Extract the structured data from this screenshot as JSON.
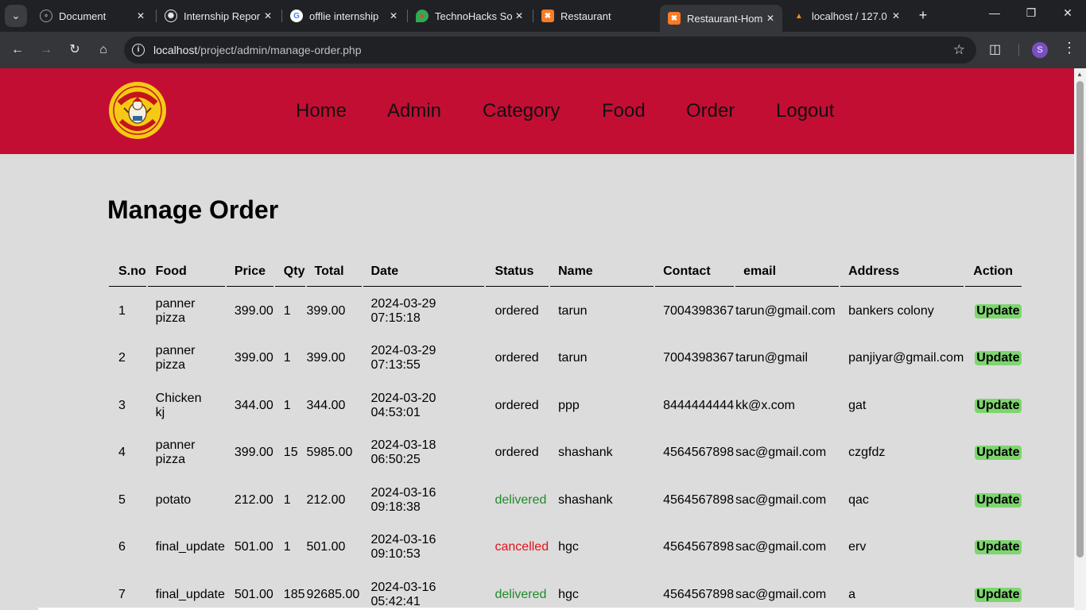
{
  "browser": {
    "tabs": [
      {
        "title": "Document",
        "favicon": "globe-icon",
        "active": false
      },
      {
        "title": "Internship Repor",
        "favicon": "chatgpt-icon",
        "active": false
      },
      {
        "title": "offlie internship",
        "favicon": "google-icon",
        "active": false
      },
      {
        "title": "TechnoHacks So",
        "favicon": "maps-pin-icon",
        "active": false
      },
      {
        "title": "Restaurant",
        "favicon": "xampp-icon",
        "active": false
      },
      {
        "title": "Restaurant-Hom",
        "favicon": "xampp-icon",
        "active": true
      },
      {
        "title": "localhost / 127.0",
        "favicon": "phpmyadmin-icon",
        "active": false
      }
    ],
    "url_host": "localhost",
    "url_path": "/project/admin/manage-order.php",
    "profile_initial": "S",
    "accent": "#7b4fbf"
  },
  "site": {
    "header_color": "#c30e33",
    "logo_text": "LOS POLLOS HERMANOS",
    "nav": [
      "Home",
      "Admin",
      "Category",
      "Food",
      "Order",
      "Logout"
    ]
  },
  "page": {
    "title": "Manage Order",
    "columns": [
      "S.no",
      "Food",
      "Price",
      "Qty",
      "Total",
      "Date",
      "Status",
      "Name",
      "Contact",
      "email",
      "Address",
      "Action"
    ],
    "rows": [
      {
        "sno": "1",
        "food": [
          "panner",
          "pizza"
        ],
        "price": "399.00",
        "qty": "1",
        "total": "399.00",
        "date": [
          "2024-03-29",
          "07:15:18"
        ],
        "status": "ordered",
        "name": "tarun",
        "contact": "7004398367",
        "email": "tarun@gmail.com",
        "address": "bankers colony",
        "action": "Update"
      },
      {
        "sno": "2",
        "food": [
          "panner",
          "pizza"
        ],
        "price": "399.00",
        "qty": "1",
        "total": "399.00",
        "date": [
          "2024-03-29",
          "07:13:55"
        ],
        "status": "ordered",
        "name": "tarun",
        "contact": "7004398367",
        "email": "tarun@gmail",
        "address": "panjiyar@gmail.com",
        "action": "Update"
      },
      {
        "sno": "3",
        "food": [
          "Chicken",
          "kj"
        ],
        "price": "344.00",
        "qty": "1",
        "total": "344.00",
        "date": [
          "2024-03-20",
          "04:53:01"
        ],
        "status": "ordered",
        "name": "ppp",
        "contact": "8444444444",
        "email": "kk@x.com",
        "address": "gat",
        "action": "Update"
      },
      {
        "sno": "4",
        "food": [
          "panner",
          "pizza"
        ],
        "price": "399.00",
        "qty": "15",
        "total": "5985.00",
        "date": [
          "2024-03-18",
          "06:50:25"
        ],
        "status": "ordered",
        "name": "shashank",
        "contact": "4564567898",
        "email": "sac@gmail.com",
        "address": "czgfdz",
        "action": "Update"
      },
      {
        "sno": "5",
        "food": [
          "potato"
        ],
        "price": "212.00",
        "qty": "1",
        "total": "212.00",
        "date": [
          "2024-03-16",
          "09:18:38"
        ],
        "status": "delivered",
        "name": "shashank",
        "contact": "4564567898",
        "email": "sac@gmail.com",
        "address": "qac",
        "action": "Update"
      },
      {
        "sno": "6",
        "food": [
          "final_update"
        ],
        "price": "501.00",
        "qty": "1",
        "total": "501.00",
        "date": [
          "2024-03-16",
          "09:10:53"
        ],
        "status": "cancelled",
        "name": "hgc",
        "contact": "4564567898",
        "email": "sac@gmail.com",
        "address": "erv",
        "action": "Update"
      },
      {
        "sno": "7",
        "food": [
          "final_update"
        ],
        "price": "501.00",
        "qty": "185",
        "total": "92685.00",
        "date": [
          "2024-03-16",
          "05:42:41"
        ],
        "status": "delivered",
        "name": "hgc",
        "contact": "4564567898",
        "email": "sac@gmail.com",
        "address": "a",
        "action": "Update"
      }
    ]
  },
  "status_colors": {
    "ordered": "#000000",
    "delivered": "#1f8a2a",
    "cancelled": "#e5111a"
  }
}
